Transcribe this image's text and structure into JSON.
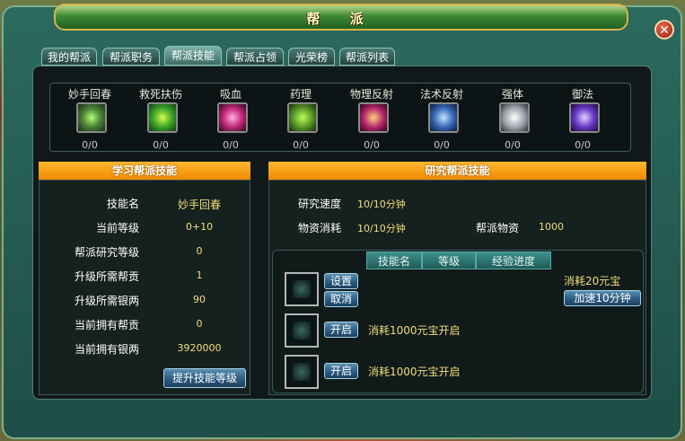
{
  "window": {
    "title": "帮 派"
  },
  "tabs": [
    "我的帮派",
    "帮派职务",
    "帮派技能",
    "帮派占领",
    "光荣榜",
    "帮派列表"
  ],
  "active_tab": "帮派技能",
  "skills": [
    {
      "name": "妙手回春",
      "count": "0/0",
      "icon": "healing-hand-icon",
      "color": "#4f8a3a"
    },
    {
      "name": "救死扶伤",
      "count": "0/0",
      "icon": "rescue-icon",
      "color": "#3ea52a"
    },
    {
      "name": "吸血",
      "count": "0/0",
      "icon": "vampire-icon",
      "color": "#c2287a"
    },
    {
      "name": "药理",
      "count": "0/0",
      "icon": "pharmacology-icon",
      "color": "#5a9a28"
    },
    {
      "name": "物理反射",
      "count": "0/0",
      "icon": "physical-reflect-icon",
      "color": "#b0206a"
    },
    {
      "name": "法术反射",
      "count": "0/0",
      "icon": "magic-reflect-icon",
      "color": "#3a6ab8"
    },
    {
      "name": "强体",
      "count": "0/0",
      "icon": "body-strength-icon",
      "color": "#9aa0a8"
    },
    {
      "name": "御法",
      "count": "0/0",
      "icon": "magic-defense-icon",
      "color": "#6a3ac8"
    }
  ],
  "learn": {
    "header": "学习帮派技能",
    "rows": [
      {
        "label": "技能名",
        "value": "妙手回春"
      },
      {
        "label": "当前等级",
        "value": "0+10"
      },
      {
        "label": "帮派研究等级",
        "value": "0"
      },
      {
        "label": "升级所需帮贡",
        "value": "1"
      },
      {
        "label": "升级所需银两",
        "value": "90"
      },
      {
        "label": "当前拥有帮贡",
        "value": "0"
      },
      {
        "label": "当前拥有银两",
        "value": "3920000"
      }
    ],
    "upgrade_button": "提升技能等级"
  },
  "research": {
    "header": "研究帮派技能",
    "speed_label": "研究速度",
    "speed_value": "10/10分钟",
    "consume_label": "物资消耗",
    "consume_value": "10/10分钟",
    "supply_label": "帮派物资",
    "supply_value": "1000",
    "columns": [
      "技能名",
      "等级",
      "经验进度"
    ],
    "slot1": {
      "set": "设置",
      "cancel": "取消",
      "cost": "消耗20元宝",
      "speedup": "加速10分钟"
    },
    "slot2": {
      "open": "开启",
      "note": "消耗1000元宝开启"
    },
    "slot3": {
      "open": "开启",
      "note": "消耗1000元宝开启"
    }
  }
}
